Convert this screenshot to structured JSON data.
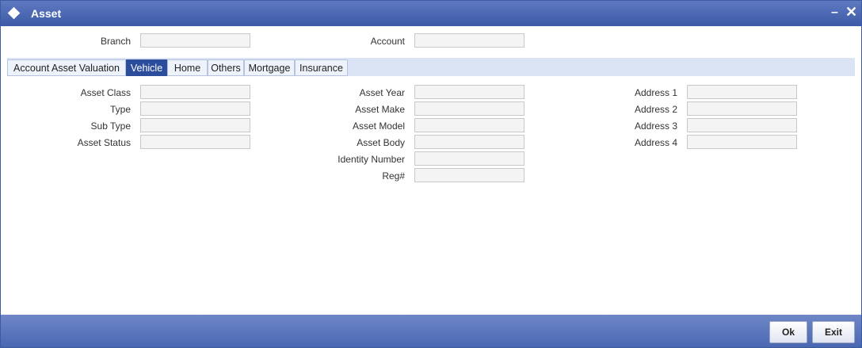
{
  "window": {
    "title": "Asset",
    "minimize_glyph": "–",
    "close_glyph": "✕"
  },
  "header": {
    "branch_label": "Branch",
    "branch_value": "",
    "account_label": "Account",
    "account_value": ""
  },
  "tabs": [
    {
      "label": "Account Asset Valuation",
      "active": false
    },
    {
      "label": "Vehicle",
      "active": true
    },
    {
      "label": "Home",
      "active": false
    },
    {
      "label": "Others",
      "active": false
    },
    {
      "label": "Mortgage",
      "active": false
    },
    {
      "label": "Insurance",
      "active": false
    }
  ],
  "vehicle": {
    "col1": [
      {
        "label": "Asset Class",
        "value": ""
      },
      {
        "label": "Type",
        "value": ""
      },
      {
        "label": "Sub Type",
        "value": ""
      },
      {
        "label": "Asset Status",
        "value": ""
      }
    ],
    "col2": [
      {
        "label": "Asset Year",
        "value": ""
      },
      {
        "label": "Asset Make",
        "value": ""
      },
      {
        "label": "Asset Model",
        "value": ""
      },
      {
        "label": "Asset Body",
        "value": ""
      },
      {
        "label": "Identity Number",
        "value": ""
      },
      {
        "label": "Reg#",
        "value": ""
      }
    ],
    "col3": [
      {
        "label": "Address 1",
        "value": ""
      },
      {
        "label": "Address 2",
        "value": ""
      },
      {
        "label": "Address 3",
        "value": ""
      },
      {
        "label": "Address 4",
        "value": ""
      }
    ]
  },
  "footer": {
    "ok_label": "Ok",
    "exit_label": "Exit"
  },
  "colors": {
    "titlebar": "#3c5aa6",
    "active_tab": "#2c4d9b",
    "tab_strip": "#dbe4f5",
    "footer": "#4a67b2"
  },
  "icons": {
    "title": "diamond-icon"
  }
}
